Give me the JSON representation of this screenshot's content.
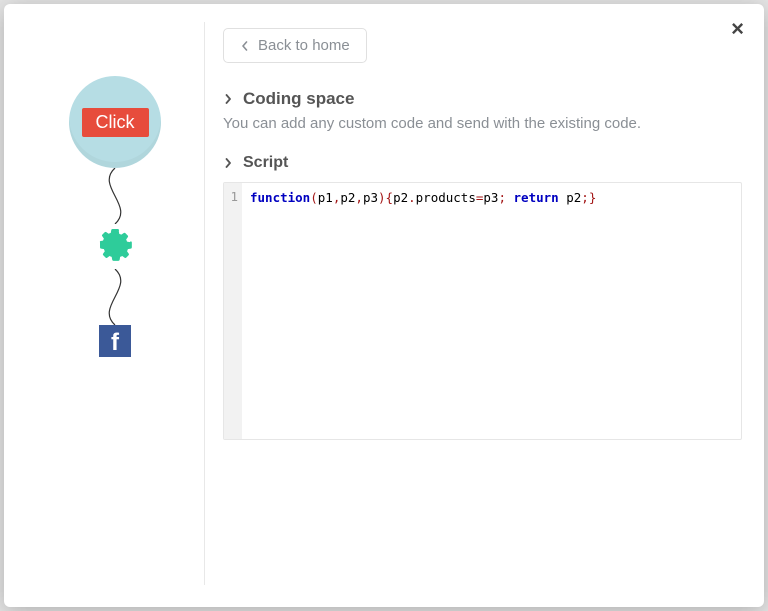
{
  "close_label": "×",
  "back_button": {
    "label": "Back to home"
  },
  "left_panel": {
    "click_label": "Click",
    "gear_icon": "gear-icon",
    "facebook_icon": "facebook-icon",
    "facebook_glyph": "f"
  },
  "sections": {
    "coding_space": {
      "title": "Coding space",
      "description": "You can add any custom code and send with the existing code."
    },
    "script": {
      "title": "Script",
      "code": {
        "line_number": "1",
        "tokens": {
          "function_kw": "function",
          "open_paren": "(",
          "p1": "p1",
          "comma1": ",",
          "p2": "p2",
          "comma2": ",",
          "p3": "p3",
          "close_paren_open_brace": "){",
          "p2b": "p2",
          "dot": ".",
          "products": "products",
          "eq": "=",
          "p3b": "p3",
          "semi1": "; ",
          "return_kw": "return",
          "sp": " ",
          "p2c": "p2",
          "semi2": ";",
          "close_brace": "}"
        }
      }
    }
  }
}
